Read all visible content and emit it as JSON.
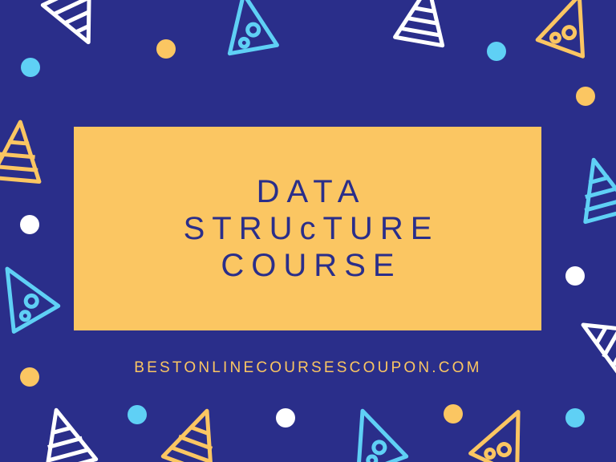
{
  "colors": {
    "background": "#2a2e8a",
    "card": "#fbc662",
    "title_text": "#2a2e8a",
    "accent_white": "#ffffff",
    "accent_cyan": "#5fd0f5",
    "accent_orange": "#fbc662"
  },
  "title": {
    "line1": "DATA",
    "line2": "STRUcTURE",
    "line3": "COURSE"
  },
  "website": "BESTONLINECOURSESCOUPON.COM",
  "decor_icons": [
    "triangle-icon",
    "circle-icon"
  ]
}
